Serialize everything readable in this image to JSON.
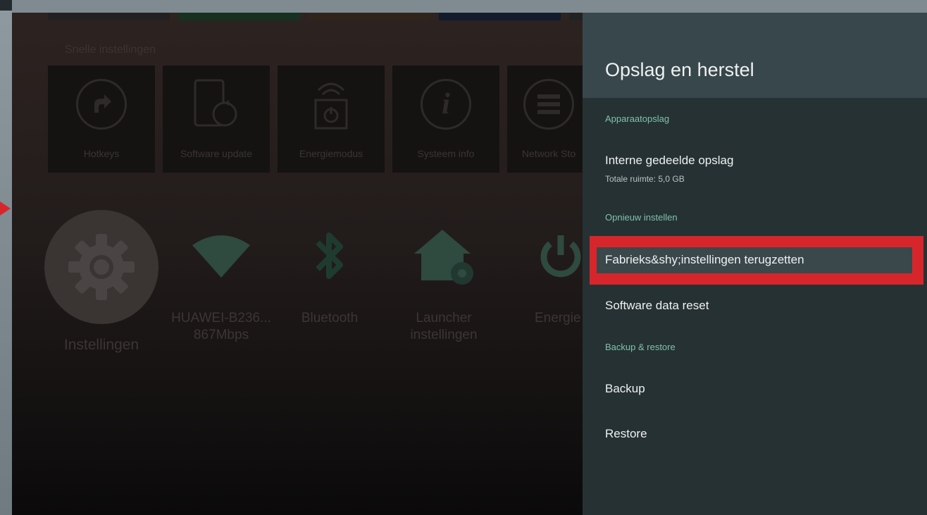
{
  "quick_settings": {
    "title": "Snelle instellingen",
    "tiles": [
      {
        "label": "Hotkeys",
        "icon": "hotkeys-arrow-icon"
      },
      {
        "label": "Software update",
        "icon": "software-update-icon"
      },
      {
        "label": "Energiemodus",
        "icon": "energy-mode-icon"
      },
      {
        "label": "Systeem info",
        "icon": "info-icon"
      },
      {
        "label": "Network Sto",
        "icon": "network-storage-icon"
      }
    ]
  },
  "apps": [
    {
      "label": "Instellingen",
      "icon": "settings-gear-icon"
    },
    {
      "label": "HUAWEI-B236...",
      "label2": "867Mbps",
      "icon": "wifi-icon"
    },
    {
      "label": "Bluetooth",
      "icon": "bluetooth-icon"
    },
    {
      "label": "Launcher",
      "label2": "instellingen",
      "icon": "launcher-home-icon"
    },
    {
      "label": "Energie",
      "icon": "power-icon"
    }
  ],
  "panel": {
    "title": "Opslag en herstel",
    "category_device_storage": "Apparaatopslag",
    "internal_storage": "Interne gedeelde opslag",
    "internal_storage_total": "Totale ruimte: 5,0 GB",
    "category_reset": "Opnieuw instellen",
    "factory_reset": "Fabrieks&shy;instellingen terugzetten",
    "software_data_reset": "Software data reset",
    "category_backup": "Backup & restore",
    "backup": "Backup",
    "restore": "Restore"
  },
  "colors": {
    "accent_category": "#7fc2a9",
    "highlight_border": "#d7262b",
    "panel_bg": "#263133",
    "panel_header_bg": "#38474b"
  }
}
